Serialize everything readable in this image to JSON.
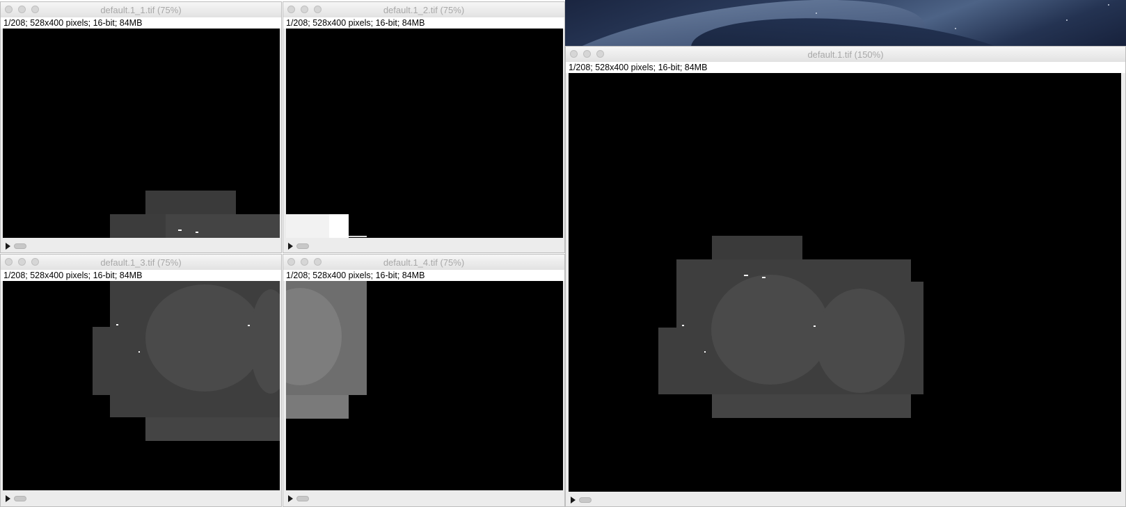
{
  "windows": [
    {
      "title": "default.1_1.tif (75%)",
      "info": "1/208; 528x400 pixels; 16-bit; 84MB"
    },
    {
      "title": "default.1_2.tif (75%)",
      "info": "1/208; 528x400 pixels; 16-bit; 84MB"
    },
    {
      "title": "default.1_3.tif (75%)",
      "info": "1/208; 528x400 pixels; 16-bit; 84MB"
    },
    {
      "title": "default.1_4.tif (75%)",
      "info": "1/208; 528x400 pixels; 16-bit; 84MB"
    },
    {
      "title": "default.1.tif (150%)",
      "info": "1/208; 528x400 pixels; 16-bit; 84MB"
    }
  ],
  "icons": {
    "close": "close-icon",
    "minimize": "minimize-icon",
    "zoom": "zoom-icon",
    "play": "play-icon"
  },
  "colors": {
    "canvas_background": "#000000",
    "titlebar_text": "#a8a8a8",
    "window_chrome": "#ececec"
  }
}
